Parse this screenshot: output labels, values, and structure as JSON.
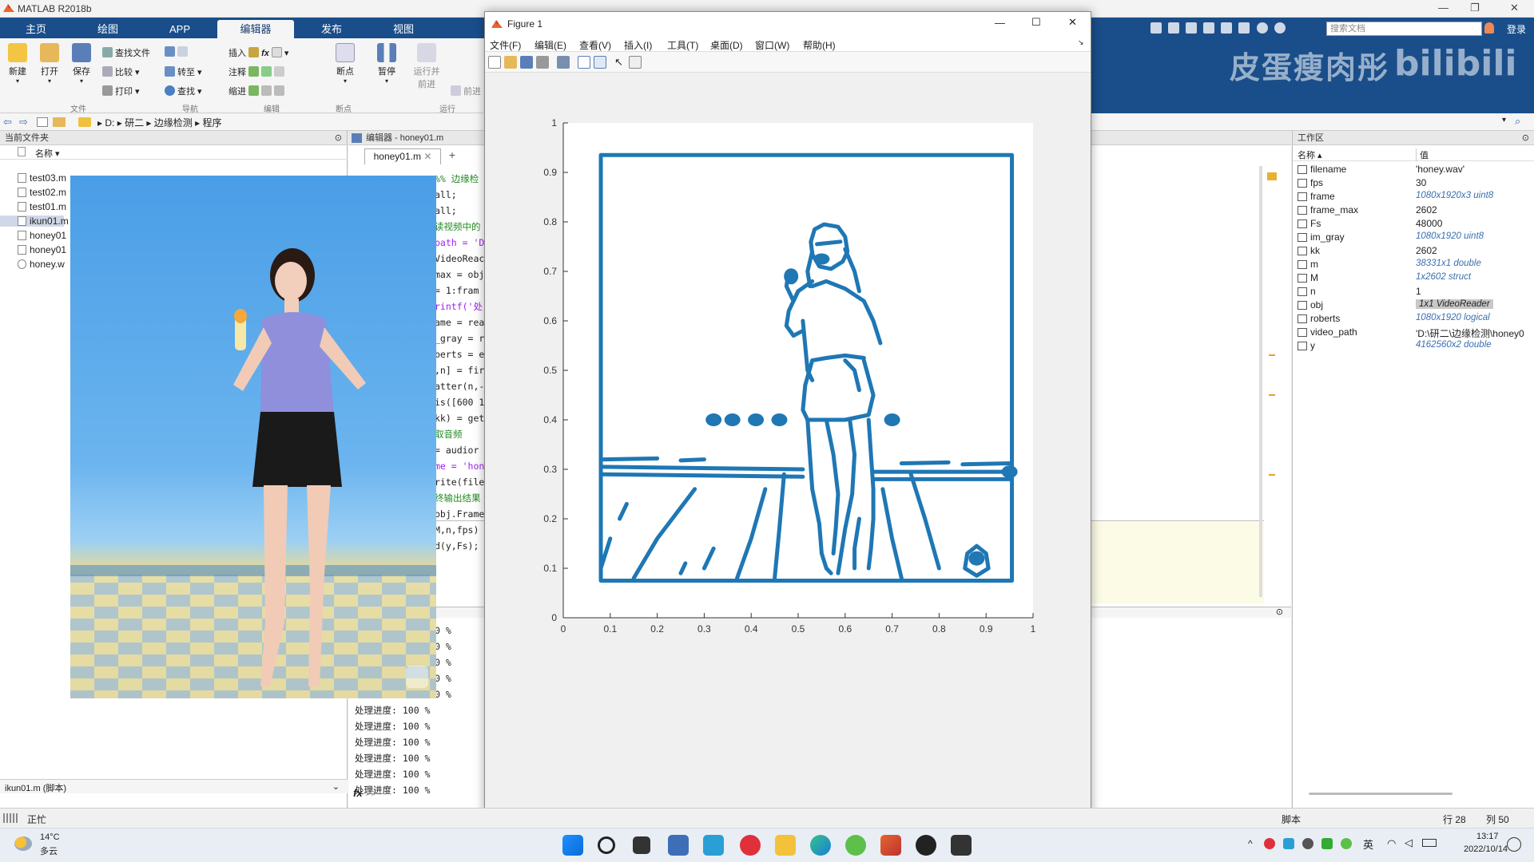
{
  "app": {
    "title": "MATLAB R2018b",
    "tabs": [
      "主页",
      "绘图",
      "APP",
      "编辑器",
      "发布",
      "视图"
    ],
    "active_tab": "编辑器",
    "search_placeholder": "搜索文档",
    "login_label": "登录",
    "watermark": "皮蛋瘦肉彤"
  },
  "ribbon": {
    "new_label": "新建",
    "open_label": "打开",
    "save_label": "保存",
    "find_files_label": "查找文件",
    "compare_label": "比较",
    "print_label": "打印",
    "goto_label": "转至",
    "find_label": "查找",
    "insert_label": "插入",
    "comment_label": "注释",
    "indent_label": "缩进",
    "breakpoints_label": "断点",
    "run_label": "暂停",
    "run_advance_label": "运行并\n前进",
    "advance_label": "前进",
    "group_file": "文件",
    "group_nav": "导航",
    "group_edit": "编辑",
    "group_bp": "断点",
    "group_run": "运行"
  },
  "address": {
    "crumbs": [
      "D:",
      "研二",
      "边缘检测",
      "程序"
    ]
  },
  "current_folder": {
    "title": "当前文件夹",
    "col_name": "名称",
    "files": [
      "test03.m",
      "test02.m",
      "test01.m",
      "ikun01.m",
      "honey01",
      "honey01",
      "honey.w"
    ],
    "footer_file": "ikun01.m (脚本)"
  },
  "editor": {
    "title": "编辑器 - honey01.m",
    "tab_label": "honey01.m",
    "code_lines": [
      "%% 边缘检",
      "all;",
      "all;",
      "",
      "读视频中的",
      "path = 'D",
      "VideoReac",
      "max = obj",
      "= 1:fram",
      "rintf('处",
      "ame = rea",
      "_gray = r",
      "berts = e",
      ",n] = fir",
      "atter(n,-",
      "is([600 1",
      "kk) = get",
      "",
      "取音频",
      "= audior",
      "me = 'hon",
      "rite(file",
      "终输出结果",
      "obj.Frame",
      "",
      "M,n,fps)",
      "d(y,Fs);"
    ]
  },
  "command": {
    "progress_partial": [
      "0 %",
      "0 %",
      "0 %",
      "0 %",
      "0 %"
    ],
    "progress_lines": [
      "处理进度: 100 %",
      "处理进度: 100 %",
      "处理进度: 100 %",
      "处理进度: 100 %",
      "处理进度: 100 %",
      "处理进度: 100 %"
    ],
    "prompt": "fx >>"
  },
  "figure": {
    "title": "Figure 1",
    "menu": [
      "文件(F)",
      "编辑(E)",
      "查看(V)",
      "插入(I)",
      "工具(T)",
      "桌面(D)",
      "窗口(W)",
      "帮助(H)"
    ]
  },
  "chart_data": {
    "type": "scatter",
    "title": "",
    "xlabel": "",
    "ylabel": "",
    "xlim": [
      0,
      1
    ],
    "ylim": [
      0,
      1
    ],
    "xticks": [
      "0",
      "0.1",
      "0.2",
      "0.3",
      "0.4",
      "0.5",
      "0.6",
      "0.7",
      "0.8",
      "0.9",
      "1"
    ],
    "yticks": [
      "0",
      "0.1",
      "0.2",
      "0.3",
      "0.4",
      "0.5",
      "0.6",
      "0.7",
      "0.8",
      "0.9",
      "1"
    ],
    "color": "#1f77b4",
    "description_of_points": "Roberts edge-detection points of video frame"
  },
  "workspace": {
    "title": "工作区",
    "col_name": "名称",
    "col_value": "值",
    "vars": [
      {
        "name": "filename",
        "value": "'honey.wav'",
        "italic": false
      },
      {
        "name": "fps",
        "value": "30",
        "italic": false
      },
      {
        "name": "frame",
        "value": "1080x1920x3 uint8",
        "italic": true
      },
      {
        "name": "frame_max",
        "value": "2602",
        "italic": false
      },
      {
        "name": "Fs",
        "value": "48000",
        "italic": false
      },
      {
        "name": "im_gray",
        "value": "1080x1920 uint8",
        "italic": true
      },
      {
        "name": "kk",
        "value": "2602",
        "italic": false
      },
      {
        "name": "m",
        "value": "38331x1 double",
        "italic": true
      },
      {
        "name": "M",
        "value": "1x2602 struct",
        "italic": true
      },
      {
        "name": "n",
        "value": "1",
        "italic": false
      },
      {
        "name": "obj",
        "value": "1x1 VideoReader",
        "italic": true
      },
      {
        "name": "roberts",
        "value": "1080x1920 logical",
        "italic": true
      },
      {
        "name": "video_path",
        "value": "'D:\\研二\\边缘检测\\honey0",
        "italic": false
      },
      {
        "name": "y",
        "value": "4162560x2 double",
        "italic": true
      }
    ]
  },
  "status": {
    "busy": "正忙",
    "mode": "脚本",
    "row_label": "行",
    "row": "28",
    "col_label": "列",
    "col": "50"
  },
  "taskbar": {
    "weather_temp": "14°C",
    "weather_desc": "多云",
    "lang": "英",
    "time": "13:17",
    "date": "2022/10/14"
  }
}
